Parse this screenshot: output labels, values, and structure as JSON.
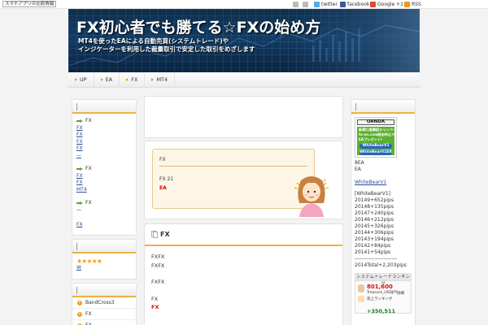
{
  "topbar": {
    "ad_link": "スマホアプリの比較情報",
    "twitter": "twitter",
    "facebook": "facebook",
    "google": "Google +1",
    "rss": "RSS"
  },
  "banner": {
    "title": "FX初心者でも勝てる☆FXの始め方",
    "sub_line1": "MT4を使ったEAによる自動売買(システムトレード)や",
    "sub_line2": "インジケーターを利用した裁量取引で安定した取引をめざします"
  },
  "nav": [
    "UP",
    "EA",
    "FX",
    "MT4"
  ],
  "left_widget": {
    "groups": [
      {
        "title": "FX",
        "links": [
          "FX",
          "FX",
          "FX",
          "FX"
        ],
        "extra": "—"
      },
      {
        "title": "FX",
        "links": [
          "FX",
          "FX",
          "MT4"
        ],
        "extra": ""
      },
      {
        "title": "FX",
        "links": [
          "FX"
        ],
        "extra": "—"
      }
    ]
  },
  "left_widget2": {
    "stars": "★★★★★",
    "link": "W"
  },
  "left_widget3": {
    "items": [
      "BandCross3",
      "FX",
      "FX"
    ]
  },
  "notice": {
    "t1": "FX",
    "t2": "FX 21",
    "t3": "EA"
  },
  "article": {
    "title": "FX",
    "lines": [
      "FXFX",
      "FXFX",
      "",
      "FXFX",
      "",
      "FX",
      "FX"
    ]
  },
  "right_widget": {
    "oanda": {
      "logo": "OANDA",
      "line1": "新規口座開設キャンペーン",
      "line2": "fx-on.com経由申込で",
      "line3": "EAプレゼント!",
      "pill1": "WhiteBearV1",
      "pill2": "WhiteBearV1EX"
    },
    "text1": "8EA",
    "text2": "EA",
    "link": "WhiteBearV1",
    "stats": [
      "[WhiteBearV1]",
      "20149+652pips",
      "20148+135pips",
      "20147+240pips",
      "20146+212pips",
      "20145+326pips",
      "20144+306pips",
      "20143+194pips",
      "20142+84pips",
      "20141+54pips",
      "------------------------",
      "2014Total+2,203pips"
    ],
    "ranking": {
      "head": "システムトレードランキング",
      "value": "801,600",
      "label": "Treasure_USDJPY",
      "small": "詳細",
      "sub": "売上ランキング",
      "value2": "+350,511"
    }
  },
  "colors": {
    "accent": "#f0b040",
    "link": "#2a4d9a",
    "red": "#cc1111",
    "green_arrow": "#5aa33c"
  }
}
